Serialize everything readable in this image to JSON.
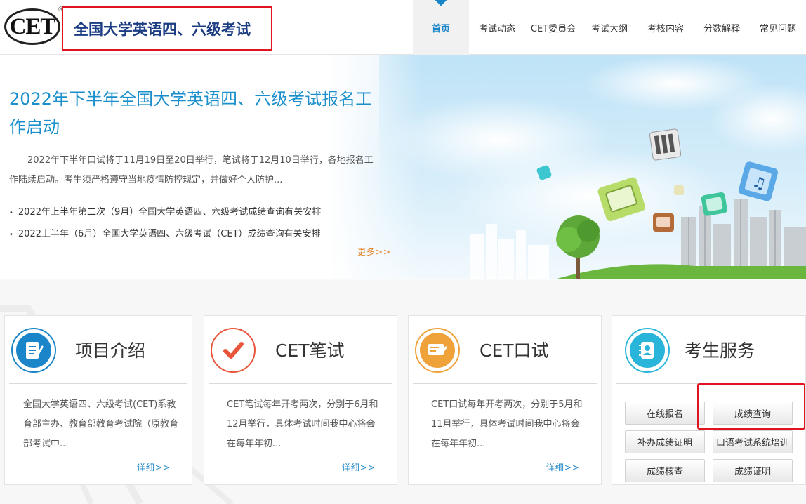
{
  "header": {
    "logo_text": "CET",
    "logo_registered": "®",
    "site_title": "全国大学英语四、六级考试",
    "nav": [
      {
        "label": "首页",
        "active": true
      },
      {
        "label": "考试动态"
      },
      {
        "label": "CET委员会"
      },
      {
        "label": "考试大纲"
      },
      {
        "label": "考核内容"
      },
      {
        "label": "分数解释"
      },
      {
        "label": "常见问题"
      }
    ]
  },
  "hero": {
    "title": "2022年下半年全国大学英语四、六级考试报名工作启动",
    "description": "2022年下半年口试将于11月19日至20日举行，笔试将于12月10日举行，各地报名工作陆续启动。考生须严格遵守当地疫情防控规定，并做好个人防护...",
    "links": [
      "2022年上半年第二次（9月）全国大学英语四、六级考试成绩查询有关安排",
      "2022上半年（6月）全国大学英语四、六级考试（CET）成绩查询有关安排"
    ],
    "more": "更多>>"
  },
  "cards": [
    {
      "title": "项目介绍",
      "icon": "document-edit-icon",
      "color": "#1a86c9",
      "text": "全国大学英语四、六级考试(CET)系教育部主办、教育部教育考试院（原教育部考试中...",
      "more": "详细>>"
    },
    {
      "title": "CET笔试",
      "icon": "checkmark-icon",
      "color": "#e8553a",
      "text": "CET笔试每年开考两次，分别于6月和12月举行，具体考试时间我中心将会在每年年初...",
      "more": "详细>>"
    },
    {
      "title": "CET口试",
      "icon": "monitor-pen-icon",
      "color": "#f0a23a",
      "text": "CET口试每年开考两次，分别于5月和11月举行，具体考试时间我中心将会在每年年初...",
      "more": "详细>>"
    },
    {
      "title": "考生服务",
      "icon": "contact-book-icon",
      "color": "#29b5d9",
      "services": [
        "在线报名",
        "成绩查询",
        "补办成绩证明",
        "口语考试系统培训",
        "成绩核查",
        "成绩证明"
      ]
    }
  ],
  "colors": {
    "accent": "#1a86c9",
    "title_blue": "#1b3c82",
    "highlight_red": "#e0141e",
    "more_orange": "#e07c1a"
  }
}
